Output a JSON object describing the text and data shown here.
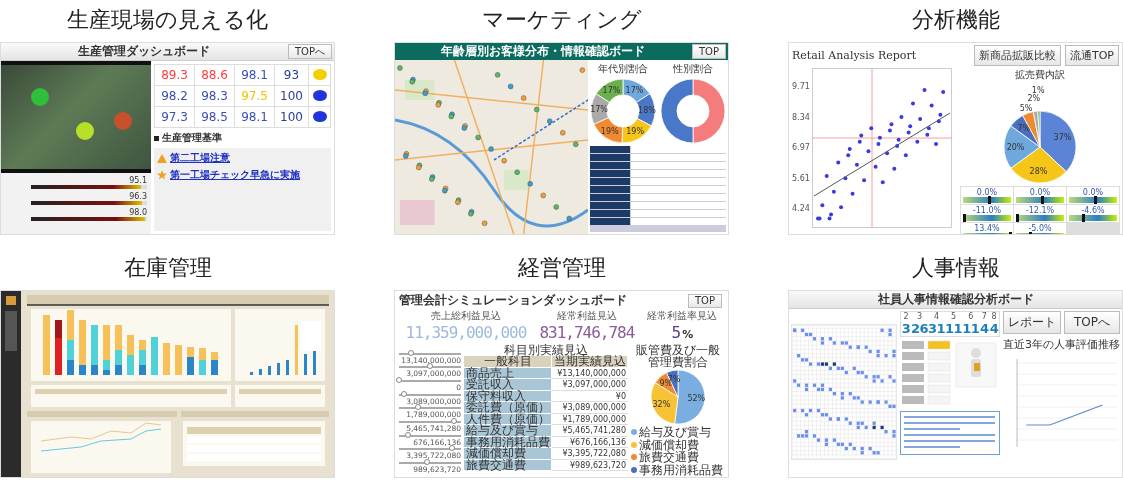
{
  "cards": [
    {
      "kind": "production",
      "title": "生産現場の見える化",
      "header": "生産管理ダッシュボード",
      "top_button": "TOPへ",
      "factory_markers": [
        {
          "color": "#2fbf3a"
        },
        {
          "color": "#b8e02a"
        },
        {
          "color": "#c8502a"
        }
      ],
      "gauges": [
        {
          "reading": "95.1",
          "level": 0.95
        },
        {
          "reading": "96.3",
          "level": 0.96
        },
        {
          "reading": "98.0",
          "level": 0.98
        }
      ],
      "rows": [
        {
          "values": [
            {
              "text": "89.3",
              "color": "#ff3b3b"
            },
            {
              "text": "88.6",
              "color": "#ff3b3b"
            },
            {
              "text": "98.1",
              "color": "#3a4fb0"
            }
          ],
          "score": "93",
          "lamp": {
            "color": "#f5d000"
          }
        },
        {
          "values": [
            {
              "text": "98.2",
              "color": "#3a4fb0"
            },
            {
              "text": "98.3",
              "color": "#3a4fb0"
            },
            {
              "text": "97.5",
              "color": "#f5c000"
            }
          ],
          "score": "100",
          "lamp": {
            "color": "#2233dd"
          }
        },
        {
          "values": [
            {
              "text": "97.3",
              "color": "#3a4fb0"
            },
            {
              "text": "98.5",
              "color": "#3a4fb0"
            },
            {
              "text": "98.1",
              "color": "#3a4fb0"
            }
          ],
          "score": "100",
          "lamp": {
            "color": "#2233dd"
          }
        }
      ],
      "criteria_title": "生産管理基準",
      "notices": [
        {
          "kind": "warning",
          "title": "第二工場注意"
        },
        {
          "kind": "star",
          "title": "第一工場チェック早急に実施"
        }
      ]
    },
    {
      "kind": "marketing",
      "title": "マーケティング",
      "header": "年齢層別お客様分布・情報確認ボード",
      "top_button": "TOP",
      "age_chart": {
        "chart_data": {
          "type": "donut",
          "title": "年代別割合",
          "values": [
            17,
            18,
            19,
            19,
            17,
            17
          ],
          "value_labels": [
            "17%",
            "18%",
            "19%",
            "19%",
            "17%",
            "17%"
          ]
        }
      },
      "gender_chart": {
        "chart_data": {
          "type": "donut",
          "title": "性別割合",
          "values": [
            50,
            50
          ]
        }
      }
    },
    {
      "kind": "analysis",
      "title": "分析機能",
      "report_title": "Retail Analysis Report",
      "buttons": [
        "新商品拡販比較",
        "流通TOP"
      ],
      "y_tick_labels": [
        "9.71",
        "8.34",
        "6.97",
        "5.61",
        "4.24"
      ],
      "pie": {
        "chart_data": {
          "type": "pie",
          "title": "拡売費内訳",
          "values": [
            37,
            28,
            20,
            7,
            5,
            2,
            1
          ],
          "value_labels": [
            "37%",
            "28%",
            "20%",
            "7%",
            "5%",
            "2%",
            "1%"
          ]
        }
      },
      "gauges": [
        {
          "reading": "0.0%",
          "level": 0.55
        },
        {
          "reading": "0.0%",
          "level": 0.55
        },
        {
          "reading": "0.0%",
          "level": 0.55
        },
        {
          "reading": "-11.0%",
          "level": 0.02
        },
        {
          "reading": "-12.1%",
          "level": 0.02
        },
        {
          "reading": "-4.6%",
          "level": 0.3
        },
        {
          "reading": "13.4%",
          "level": 0.98
        },
        {
          "reading": "-5.0%",
          "level": 0.3
        }
      ]
    },
    {
      "kind": "inventory",
      "title": "在庫管理"
    },
    {
      "kind": "management",
      "title": "経営管理",
      "header": "管理会計シミュレーションダッシュボード",
      "top_button": "TOP",
      "kpis": [
        {
          "label": "売上総利益見込",
          "value": "11,359,000,000",
          "color": "#9fb8de"
        },
        {
          "label": "経常利益見込",
          "value": "831,746,784",
          "color": "#8b5a9a"
        },
        {
          "label": "経常利益率見込",
          "value": "5",
          "unit": "%",
          "color": "#5a3a8a"
        }
      ],
      "sliders": [
        {
          "value": "13,140,000,000",
          "level": 0.2
        },
        {
          "value": "3,097,000,000",
          "level": 0.5
        },
        {
          "value": "0",
          "level": 0.0
        },
        {
          "value": "3,089,000,000",
          "level": 0.08
        },
        {
          "value": "1,789,000,000",
          "level": 0.3
        },
        {
          "value": "5,465,741,280",
          "level": 0.88
        },
        {
          "value": "676,166,136",
          "level": 0.15
        },
        {
          "value": "3,395,722,080",
          "level": 0.85
        },
        {
          "value": "989,623,720",
          "level": 0.45
        }
      ],
      "table_title": "科目別実績見込",
      "columns": [
        "一般科目",
        "当期実績見込"
      ],
      "rows": [
        [
          "商品売上",
          "¥13,140,000,000"
        ],
        [
          "受託収入",
          "¥3,097,000,000"
        ],
        [
          "保守料収入",
          "¥0"
        ],
        [
          "委託費（原価）",
          "¥3,089,000,000"
        ],
        [
          "人件費（原価）",
          "¥1,789,000,000"
        ],
        [
          "給与及び賞与",
          "¥5,465,741,280"
        ],
        [
          "事務用消耗品費",
          "¥676,166,136"
        ],
        [
          "減価償却費",
          "¥3,395,722,080"
        ],
        [
          "旅費交通費",
          "¥989,623,720"
        ]
      ],
      "pie": {
        "chart_data": {
          "type": "pie",
          "title": "販管費及び一般管理費割合",
          "categories": [
            "給与及び賞与",
            "減価償却費",
            "旅費交通費",
            "事務用消耗品費"
          ],
          "values": [
            52,
            32,
            9,
            7
          ],
          "value_labels": [
            "52%",
            "32%",
            "9%",
            "7%"
          ]
        }
      }
    },
    {
      "kind": "hr",
      "title": "人事情報",
      "header": "社員人事情報確認分析ボード",
      "buttons": [
        "レポート",
        "TOPへ"
      ],
      "counts": [
        {
          "label": "2",
          "value": "3"
        },
        {
          "label": "3",
          "value": "26"
        },
        {
          "label": "4",
          "value": "31"
        },
        {
          "label": "5",
          "value": "11"
        },
        {
          "label": "6",
          "value": "11"
        },
        {
          "label": "7",
          "value": "4"
        },
        {
          "label": "8",
          "value": "4"
        }
      ],
      "trend_title": "直近3年の人事評価推移"
    }
  ]
}
